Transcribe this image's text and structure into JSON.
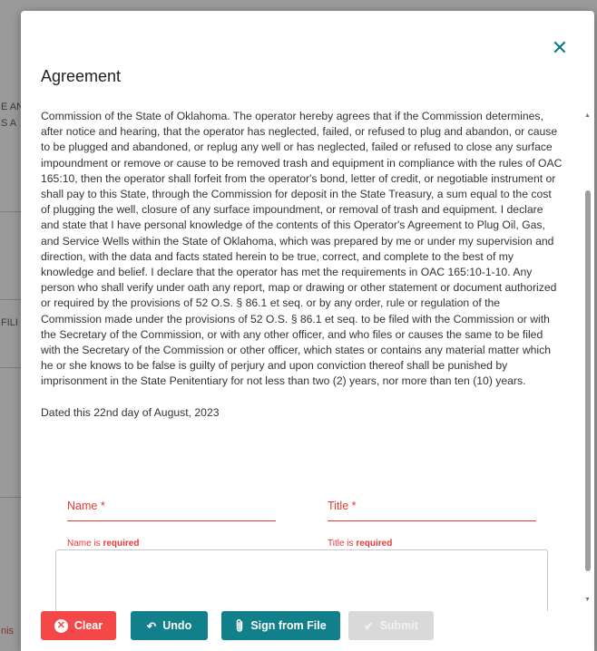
{
  "modal": {
    "title": "Agreement",
    "close_icon": "close-icon",
    "agreement_text": "Commission of the State of Oklahoma. The operator hereby agrees that if the Commission determines, after notice and hearing, that the operator has neglected, failed, or refused to plug and abandon, or cause to be plugged and abandoned, or replug any well or has neglected, failed or refused to close any surface impoundment or remove or cause to be removed trash and equipment in compliance with the rules of OAC 165:10, then the operator shall forfeit from the operator's bond, letter of credit, or negotiable instrument or shall pay to this State, through the Commission for deposit in the State Treasury, a sum equal to the cost of plugging the well, closure of any surface impoundment, or removal of trash and equipment. I declare and state that I have personal knowledge of the contents of this Operator's Agreement to Plug Oil, Gas, and Service Wells within the State of Oklahoma, which was prepared by me or under my supervision and direction, with the data and facts stated herein to be true, correct, and complete to the best of my knowledge and belief. I declare that the operator has met the requirements in OAC 165:10-1-10. Any person who shall verify under oath any report, map or drawing or other statement or document authorized or required by the provisions of 52 O.S. § 86.1 et seq. or by any order, rule or regulation of the Commission made under the provisions of 52 O.S. § 86.1 et seq. to be filed with the Commission or with the Secretary of the Commission, or with any other officer, and who files or causes the same to be filed with the Secretary of the Commission or other officer, which states or contains any material matter which he or she knows to be false is guilty of perjury and upon conviction thereof shall be punished by imprisonment in the State Penitentiary for not less than two (2) years, nor more than ten (10) years.",
    "dated": "Dated this 22nd day of August, 2023",
    "name_field": {
      "label": "Name *",
      "error_prefix": "Name is ",
      "error_strong": "required"
    },
    "title_field": {
      "label": "Title *",
      "error_prefix": "Title is ",
      "error_strong": "required"
    },
    "buttons": {
      "clear": "Clear",
      "undo": "Undo",
      "sign_from_file": "Sign from File",
      "submit": "Submit"
    }
  },
  "background": {
    "fragments": [
      "E AN",
      "S A",
      "FILI",
      "nis"
    ]
  },
  "colors": {
    "accent": "#11808a",
    "danger": "#f44848",
    "error_text": "#e53935",
    "disabled": "#d9d9d9"
  }
}
